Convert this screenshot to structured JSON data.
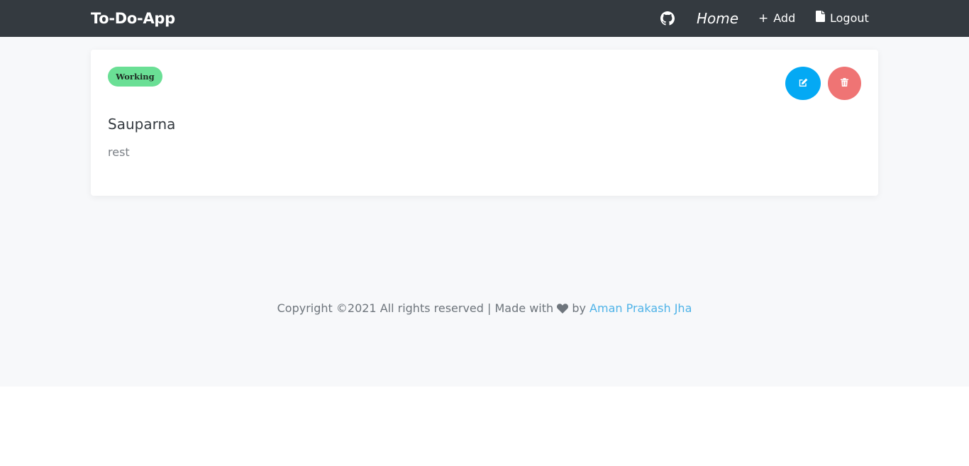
{
  "navbar": {
    "brand": "To-Do-App",
    "github_icon": "github-icon",
    "home_label": "Home",
    "add_label": "Add",
    "add_icon": "plus-icon",
    "logout_label": "Logout",
    "logout_icon": "file-icon",
    "background": "#343a40"
  },
  "todos": [
    {
      "status": "Working",
      "status_color": "#6adf95",
      "title": "Sauparna",
      "description": "rest",
      "edit_icon": "edit-icon",
      "delete_icon": "trash-icon",
      "edit_color": "#04a9f4",
      "delete_color": "#ef7474"
    }
  ],
  "footer": {
    "text_before": "Copyright ©2021 All rights reserved | Made with",
    "heart_icon": "heart-icon",
    "text_by": "by",
    "author": "Aman Prakash Jha",
    "link_color": "#4fb3e8"
  }
}
